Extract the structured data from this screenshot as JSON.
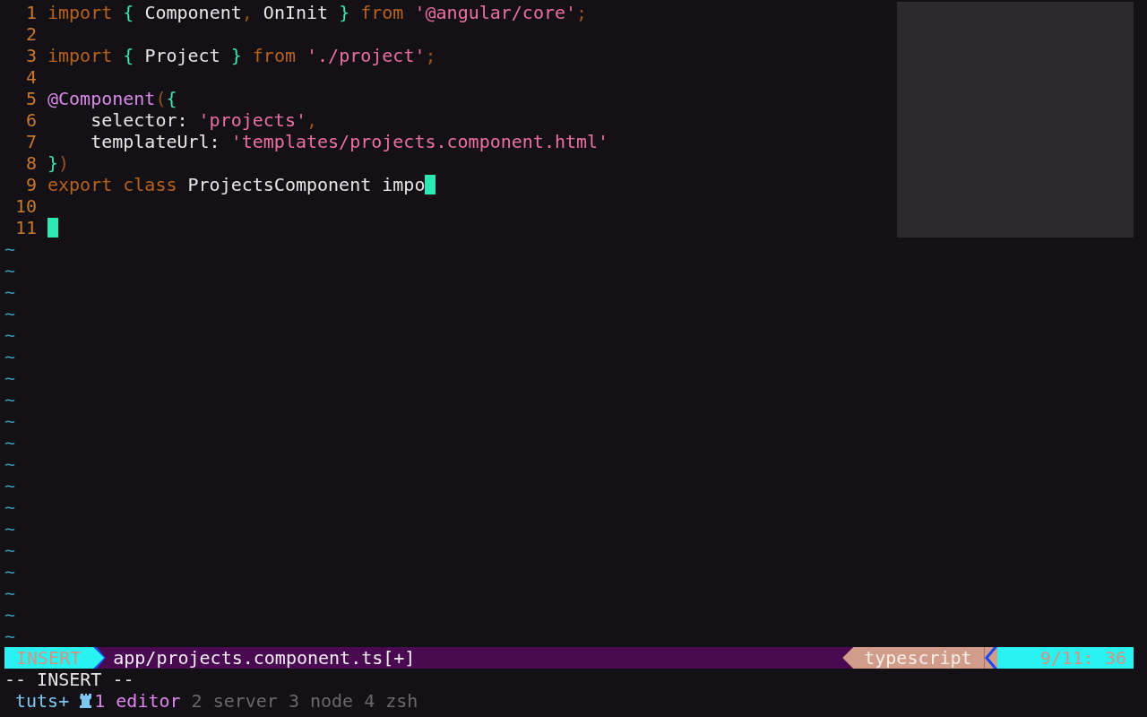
{
  "editor": {
    "lines": [
      {
        "number": "1",
        "cursor": false,
        "tokens": [
          {
            "kind": "keyword",
            "text": "import"
          },
          {
            "kind": "brace",
            "text": " {"
          },
          {
            "kind": "plain",
            "text": " Component"
          },
          {
            "kind": "punct",
            "text": ","
          },
          {
            "kind": "plain",
            "text": " OnInit"
          },
          {
            "kind": "brace",
            "text": " }"
          },
          {
            "kind": "keyword",
            "text": " from"
          },
          {
            "kind": "string",
            "text": " '@angular/core'"
          },
          {
            "kind": "punct",
            "text": ";"
          }
        ]
      },
      {
        "number": "2",
        "cursor": false
      },
      {
        "number": "3",
        "cursor": false,
        "tokens": [
          {
            "kind": "keyword",
            "text": "import"
          },
          {
            "kind": "brace",
            "text": " {"
          },
          {
            "kind": "plain",
            "text": " Project"
          },
          {
            "kind": "brace",
            "text": " }"
          },
          {
            "kind": "keyword",
            "text": " from"
          },
          {
            "kind": "string",
            "text": " './project'"
          },
          {
            "kind": "punct",
            "text": ";"
          }
        ]
      },
      {
        "number": "4",
        "cursor": false
      },
      {
        "number": "5",
        "cursor": false,
        "tokens": [
          {
            "kind": "decorator",
            "text": "@Component"
          },
          {
            "kind": "punct",
            "text": "("
          },
          {
            "kind": "brace",
            "text": "{"
          }
        ]
      },
      {
        "number": "6",
        "cursor": false,
        "tokens": [
          {
            "kind": "plain",
            "text": "    selector: "
          },
          {
            "kind": "string",
            "text": "'projects'"
          },
          {
            "kind": "punct",
            "text": ","
          }
        ]
      },
      {
        "number": "7",
        "cursor": false,
        "tokens": [
          {
            "kind": "plain",
            "text": "    templateUrl: "
          },
          {
            "kind": "string",
            "text": "'templates/projects.component.html'"
          }
        ]
      },
      {
        "number": "8",
        "cursor": false,
        "tokens": [
          {
            "kind": "brace",
            "text": "}"
          },
          {
            "kind": "punct",
            "text": ")"
          }
        ]
      },
      {
        "number": "9",
        "cursor": true,
        "tokens": [
          {
            "kind": "keyword",
            "text": "export"
          },
          {
            "kind": "keyword",
            "text": " class"
          },
          {
            "kind": "plain",
            "text": " ProjectsComponent impo"
          }
        ]
      },
      {
        "number": "10",
        "cursor": false
      },
      {
        "number": "11",
        "cursor": true
      }
    ],
    "filler_lines": [
      "~",
      "~",
      "~",
      "~",
      "~",
      "~",
      "~",
      "~",
      "~",
      "~",
      "~",
      "~",
      "~",
      "~",
      "~",
      "~",
      "~",
      "~",
      "~"
    ]
  },
  "status_line": {
    "mode": "INSERT",
    "file": "app/projects.component.ts[+]",
    "filetype": "typescript",
    "position": "9/11: 36"
  },
  "command_line": "-- INSERT --",
  "tmux": {
    "session": "tuts+",
    "windows": [
      {
        "index": "1",
        "name": "editor",
        "selected": true
      },
      {
        "index": "2",
        "name": "server",
        "selected": false
      },
      {
        "index": "3",
        "name": "node",
        "selected": false
      },
      {
        "index": "4",
        "name": "zsh",
        "selected": false
      }
    ]
  }
}
